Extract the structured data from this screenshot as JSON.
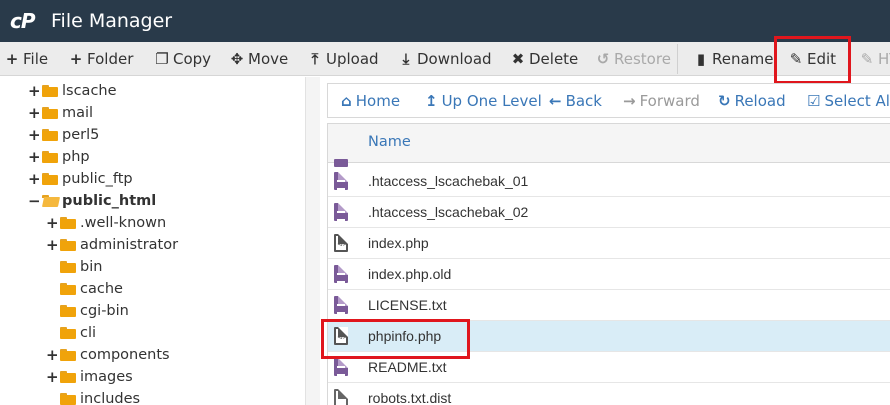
{
  "header": {
    "logo": "cP",
    "title": "File Manager"
  },
  "toolbar": {
    "file": "File",
    "folder": "Folder",
    "copy": "Copy",
    "move": "Move",
    "upload": "Upload",
    "download": "Download",
    "delete": "Delete",
    "restore": "Restore",
    "rename": "Rename",
    "edit": "Edit",
    "html": "HT"
  },
  "tree": {
    "items": [
      {
        "label": "lscache",
        "expander": "+",
        "open": false
      },
      {
        "label": "mail",
        "expander": "+",
        "open": false
      },
      {
        "label": "perl5",
        "expander": "+",
        "open": false
      },
      {
        "label": "php",
        "expander": "+",
        "open": false
      },
      {
        "label": "public_ftp",
        "expander": "+",
        "open": false
      },
      {
        "label": "public_html",
        "expander": "−",
        "open": true
      },
      {
        "label": ".well-known",
        "expander": "+",
        "open": false
      },
      {
        "label": "administrator",
        "expander": "+",
        "open": false
      },
      {
        "label": "bin",
        "expander": "",
        "open": false
      },
      {
        "label": "cache",
        "expander": "",
        "open": false
      },
      {
        "label": "cgi-bin",
        "expander": "",
        "open": false
      },
      {
        "label": "cli",
        "expander": "",
        "open": false
      },
      {
        "label": "components",
        "expander": "+",
        "open": false
      },
      {
        "label": "images",
        "expander": "+",
        "open": false
      },
      {
        "label": "includes",
        "expander": "",
        "open": false
      }
    ]
  },
  "nav": {
    "home": "Home",
    "up": "Up One Level",
    "back": "Back",
    "forward": "Forward",
    "reload": "Reload",
    "select_all": "Select All"
  },
  "files": {
    "column_name": "Name",
    "rows": [
      {
        "name": ".htaccess_lscachebak_01",
        "icon": "text-file-icon"
      },
      {
        "name": ".htaccess_lscachebak_02",
        "icon": "text-file-icon"
      },
      {
        "name": "index.php",
        "icon": "code-file-icon"
      },
      {
        "name": "index.php.old",
        "icon": "text-file-icon"
      },
      {
        "name": "LICENSE.txt",
        "icon": "text-file-icon"
      },
      {
        "name": "phpinfo.php",
        "icon": "code-file-icon",
        "selected": true
      },
      {
        "name": "README.txt",
        "icon": "text-file-icon"
      },
      {
        "name": "robots.txt.dist",
        "icon": "file-icon"
      }
    ]
  },
  "colors": {
    "header_bg": "#293a4a",
    "link": "#3a77b7",
    "highlight": "#e0161d",
    "selected_row": "#d9edf7",
    "folder": "#f0a30a"
  }
}
